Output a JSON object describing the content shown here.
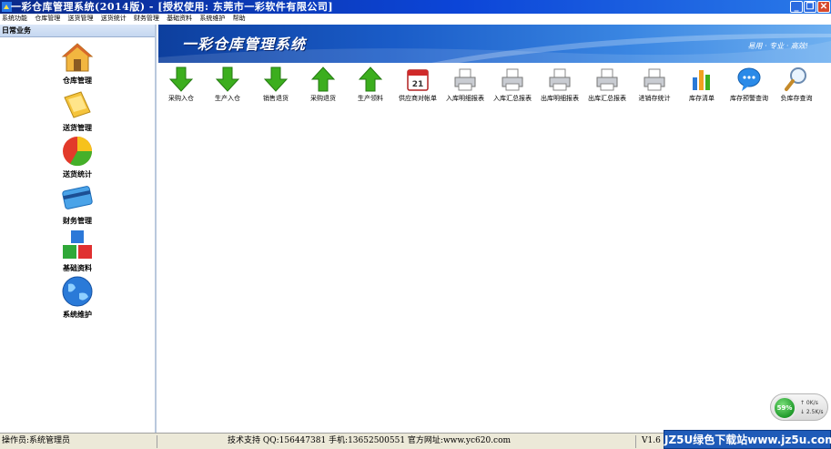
{
  "window": {
    "title": "一彩仓库管理系统(2014版) - [授权使用: 东莞市一彩软件有限公司]",
    "buttons": {
      "minimize": "_",
      "maximize": "❐",
      "close": "✕"
    }
  },
  "menu": [
    "系统功能",
    "仓库管理",
    "送货管理",
    "送货统计",
    "财务管理",
    "基础资料",
    "系统维护",
    "帮助"
  ],
  "sidebar": {
    "header": "日常业务",
    "items": [
      {
        "label": "仓库管理",
        "icon": "warehouse-house-icon"
      },
      {
        "label": "送货管理",
        "icon": "folder-document-icon"
      },
      {
        "label": "送货统计",
        "icon": "pie-chart-icon"
      },
      {
        "label": "财务管理",
        "icon": "credit-card-icon"
      },
      {
        "label": "基础资料",
        "icon": "colored-blocks-icon"
      },
      {
        "label": "系统维护",
        "icon": "globe-icon"
      }
    ]
  },
  "banner": {
    "title": "一彩仓库管理系统",
    "slogan": "易用 · 专业 · 高效!"
  },
  "toolbar": [
    {
      "label": "采购入仓",
      "icon": "green-down-arrow-icon"
    },
    {
      "label": "生产入仓",
      "icon": "green-down-arrow-icon"
    },
    {
      "label": "销售退货",
      "icon": "green-down-arrow-icon"
    },
    {
      "label": "采购退货",
      "icon": "green-up-arrow-icon"
    },
    {
      "label": "生产领料",
      "icon": "green-up-arrow-icon"
    },
    {
      "label": "供应商对帐单",
      "icon": "calendar-icon",
      "calendar_day": "21"
    },
    {
      "label": "入库明细报表",
      "icon": "printer-icon"
    },
    {
      "label": "入库汇总报表",
      "icon": "printer-icon"
    },
    {
      "label": "出库明细报表",
      "icon": "printer-icon"
    },
    {
      "label": "出库汇总报表",
      "icon": "printer-icon"
    },
    {
      "label": "进销存统计",
      "icon": "printer-icon"
    },
    {
      "label": "库存清单",
      "icon": "bar-chart-icon"
    },
    {
      "label": "库存预警查询",
      "icon": "speech-bubble-icon"
    },
    {
      "label": "负库存查询",
      "icon": "magnifier-icon"
    }
  ],
  "widget": {
    "percent": "59%",
    "upload": "↑ 0K/s",
    "download": "↓ 2.5K/s"
  },
  "status": {
    "operator": "操作员:系统管理员",
    "support": "技术支持 QQ:156447381 手机:13652500551 官方网址:www.yc620.com",
    "version": "V1.6"
  },
  "watermark": "JZ5U绿色下载站www.jz5u.com",
  "colors": {
    "titlebar": "#0c45d8",
    "banner": "#1a5cc8",
    "green_arrow": "#3cae1e",
    "statusbar": "#ece9d8"
  }
}
